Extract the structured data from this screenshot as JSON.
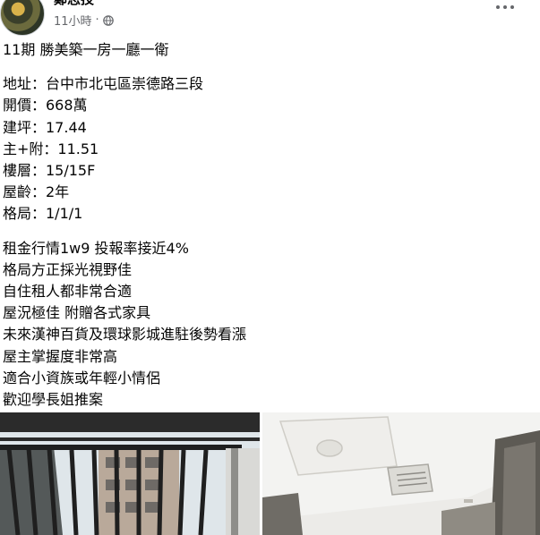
{
  "post": {
    "author": "鄭志技",
    "timestamp": "11小時",
    "separator": "·",
    "title": "11期 勝美築一房一廳一衛",
    "details": [
      "地址：台中市北屯區崇德路三段",
      "開價：668萬",
      "建坪：17.44",
      "主+附：11.51",
      "樓層：15/15F",
      "屋齡：2年",
      "格局：1/1/1"
    ],
    "highlights": [
      "租金行情1w9 投報率接近4%",
      "格局方正採光視野佳",
      "自住租人都非常合適",
      "屋況極佳 附贈各式家具",
      "未來漢神百貨及環球影城進駐後勢看漲",
      "屋主掌握度非常高",
      "適合小資族或年輕小情侶",
      "歡迎學長姐推案"
    ]
  },
  "icons": {
    "privacy": "globe-icon",
    "menu": "more-options-icon"
  },
  "colors": {
    "text": "#050505",
    "secondary_text": "#65676b"
  }
}
